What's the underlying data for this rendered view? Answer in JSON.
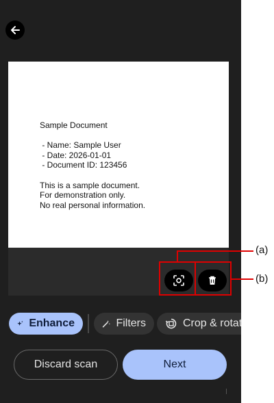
{
  "document": {
    "lines": [
      "Sample Document",
      "",
      " - Name: Sample User",
      " - Date: 2026-01-01",
      " - Document ID: 123456",
      "",
      "This is a sample document.",
      "For demonstration only.",
      "No real personal information."
    ]
  },
  "callouts": {
    "a": "(a)",
    "b": "(b)"
  },
  "chips": {
    "enhance": "Enhance",
    "filters": "Filters",
    "crop": "Crop & rotat"
  },
  "buttons": {
    "discard": "Discard scan",
    "next": "Next"
  },
  "icons": {
    "back": "arrow-back-icon",
    "recognize": "focus-scan-icon",
    "delete": "trash-icon",
    "enhance": "sparkle-icon",
    "filters": "magic-wand-icon",
    "crop": "crop-rotate-icon"
  },
  "colors": {
    "background": "#1f1f1f",
    "accent": "#a9c3fb",
    "callout": "#e00000"
  }
}
